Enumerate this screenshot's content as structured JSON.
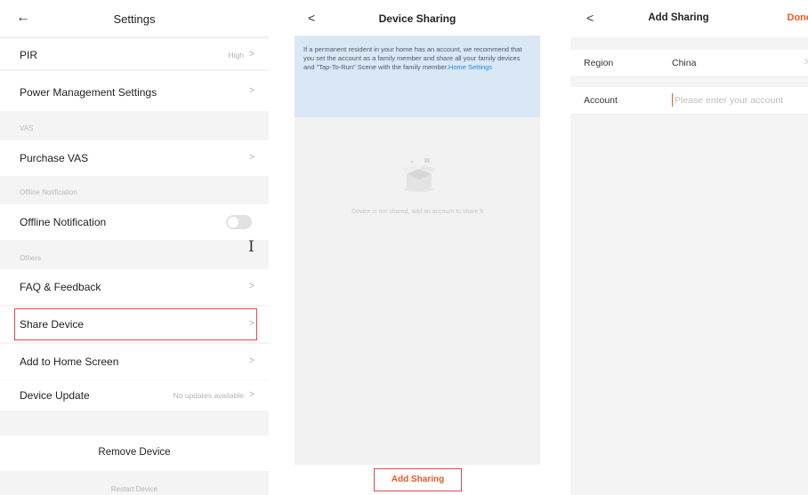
{
  "settings": {
    "title": "Settings",
    "back_icon": "←",
    "chevron": ">",
    "pir": {
      "label": "PIR",
      "value": "High"
    },
    "power": {
      "label": "Power Management Settings"
    },
    "vas_section": "VAS",
    "purchase_vas": {
      "label": "Purchase VAS"
    },
    "offline_section": "Offline Notification",
    "offline_notification": {
      "label": "Offline Notification",
      "toggle_on": false
    },
    "others_section": "Others",
    "faq": {
      "label": "FAQ & Feedback"
    },
    "share_device": {
      "label": "Share Device"
    },
    "add_home": {
      "label": "Add to Home Screen"
    },
    "device_update": {
      "label": "Device Update",
      "value": "No updates available"
    },
    "remove_device": "Remove Device",
    "restart_device": "Restart Device"
  },
  "device_sharing": {
    "title": "Device Sharing",
    "back_icon": "<",
    "banner_text": "If a permanent resident in your home has an account, we recommend that you set the account as a family member and share all your family devices and \"Tap-To-Run\" Scene with the family member.",
    "banner_link": "Home Settings",
    "empty_message": "Device is not shared, add an account to share it",
    "add_button": "Add Sharing"
  },
  "add_sharing": {
    "title": "Add Sharing",
    "back_icon": "<",
    "done_label": "Done",
    "region_label": "Region",
    "region_value": "China",
    "region_chevron": ">",
    "account_label": "Account",
    "account_placeholder": "Please enter your account"
  },
  "colors": {
    "accent_orange": "#f05a1e",
    "highlight_red": "#e5484d",
    "link_blue": "#1f86e6",
    "banner_bg": "#dae8f5"
  }
}
